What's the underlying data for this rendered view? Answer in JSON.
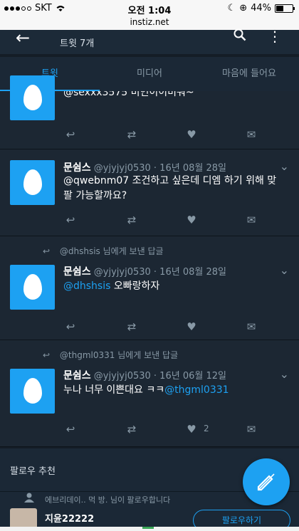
{
  "status_bar": {
    "carrier": "SKT",
    "time": "오전 1:04",
    "battery": "44%",
    "battery_level": 0.44
  },
  "browser": {
    "url": "instiz.net"
  },
  "header": {
    "subtitle": "트윗 7개"
  },
  "tabs": [
    {
      "label": "트윗"
    },
    {
      "label": "미디어"
    },
    {
      "label": "마음에 들어요"
    }
  ],
  "tweets": [
    {
      "partial_text": "@sexxx3575 미인이이미워~"
    },
    {
      "name": "문쉼스",
      "handle": "@yjyjyj0530",
      "date": "· 16년 08월 28일",
      "text": "@qwebnm07 조건하고 싶은데 디엠 하기 위해 맞팔 가능할까요?"
    },
    {
      "reply_context": "@dhshsis 님에게 보낸 답글",
      "name": "문쉼스",
      "handle": "@yjyjyj0530",
      "date": "· 16년 08월 28일",
      "mention": "@dhshsis",
      "text": "오빠랑하자"
    },
    {
      "reply_context": "@thgml0331 님에게 보낸 답글",
      "name": "문쉼스",
      "handle": "@yjyjyj0530",
      "date": "· 16년 06월 12일",
      "text": "누나 너무 이쁜대요 ㅋㅋ",
      "mention": "@thgml0331",
      "like_count": "2"
    }
  ],
  "follow_suggestions": {
    "title": "팔로우 추천",
    "note": "에브리데이.. 먹 방. 님이 팔로우합니다",
    "name": "지윤22222",
    "button_label": "팔로우하기"
  },
  "colors": {
    "accent": "#1da1f2",
    "background": "#141d26",
    "card": "#1c2733"
  },
  "icons": [
    "back-arrow-icon",
    "search-icon",
    "more-vertical-icon",
    "egg-avatar-icon",
    "reply-icon",
    "retweet-icon",
    "heart-icon",
    "direct-message-icon",
    "chevron-down-icon",
    "compose-icon",
    "person-icon"
  ]
}
